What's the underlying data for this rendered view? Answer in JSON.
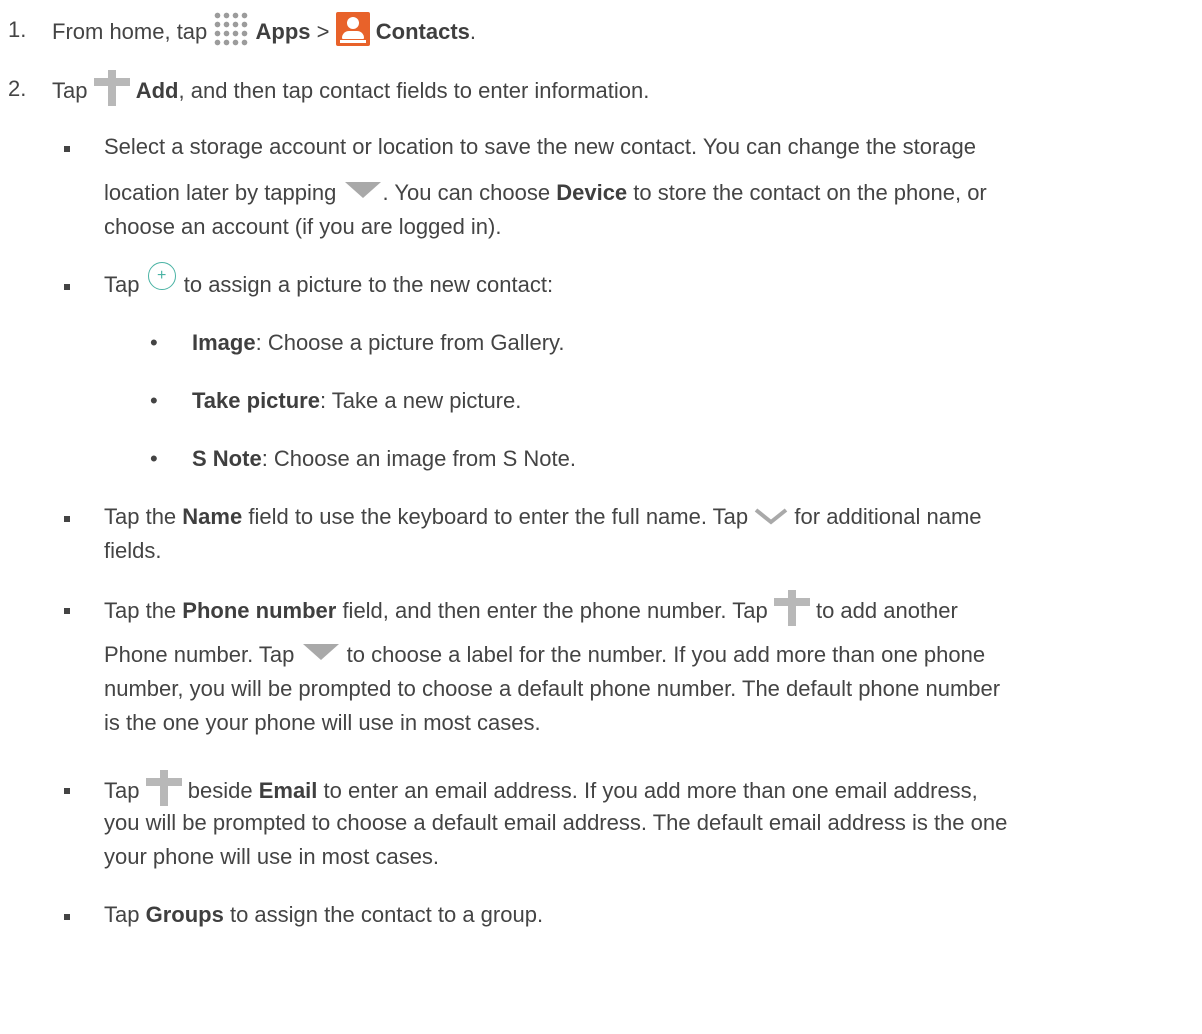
{
  "step1": {
    "number": "1.",
    "text_a": "From home, tap",
    "apps": "Apps",
    "sep": ">",
    "contacts": "Contacts",
    "end": "."
  },
  "step2": {
    "number": "2.",
    "text_a": "Tap",
    "add": "Add",
    "text_b": ", and then tap contact fields to enter information."
  },
  "storage": {
    "line1": "Select a storage account or location to save the new contact. You can change the storage",
    "l2_a": "location later by tapping",
    "l2_b": ". You can choose",
    "device": "Device",
    "l2_c": "to store the contact on the phone, or",
    "line3": "choose an account (if you are logged in)."
  },
  "picture": {
    "a": "Tap",
    "b": "to assign a picture to the new contact:"
  },
  "options": [
    {
      "label": "Image",
      "text": ": Choose a picture from Gallery."
    },
    {
      "label": "Take picture",
      "text": ": Take a new picture."
    },
    {
      "label": "S Note",
      "text": ": Choose an image from S Note."
    }
  ],
  "name": {
    "a": "Tap the",
    "label": "Name",
    "b": "field to use the keyboard to enter the full name. Tap",
    "c": "for additional name",
    "line2": "fields."
  },
  "phone": {
    "a": "Tap the",
    "label": "Phone number",
    "b": "field, and then enter the phone number. Tap",
    "c": "to add another",
    "l2_a": "Phone number. Tap",
    "l2_b": "to choose a label for the number. If you add more than one phone",
    "line3": "number, you will be prompted to choose a default phone number. The default phone number",
    "line4": "is the one your phone will use in most cases."
  },
  "email": {
    "a": "Tap",
    "b": "beside",
    "label": "Email",
    "c": "to enter an email address. If you add more than one email address,",
    "line2": "you will be prompted to choose a default email address. The default email address is the one",
    "line3": "your phone will use in most cases."
  },
  "groups": {
    "a": "Tap",
    "label": "Groups",
    "b": "to assign the contact to a group."
  },
  "icons": {
    "apps": "apps-grid-icon",
    "contacts": "contacts-icon",
    "plus": "plus-icon",
    "dropdown": "dropdown-triangle-icon",
    "picture": "circle-plus-icon",
    "expand": "chevron-down-icon"
  }
}
